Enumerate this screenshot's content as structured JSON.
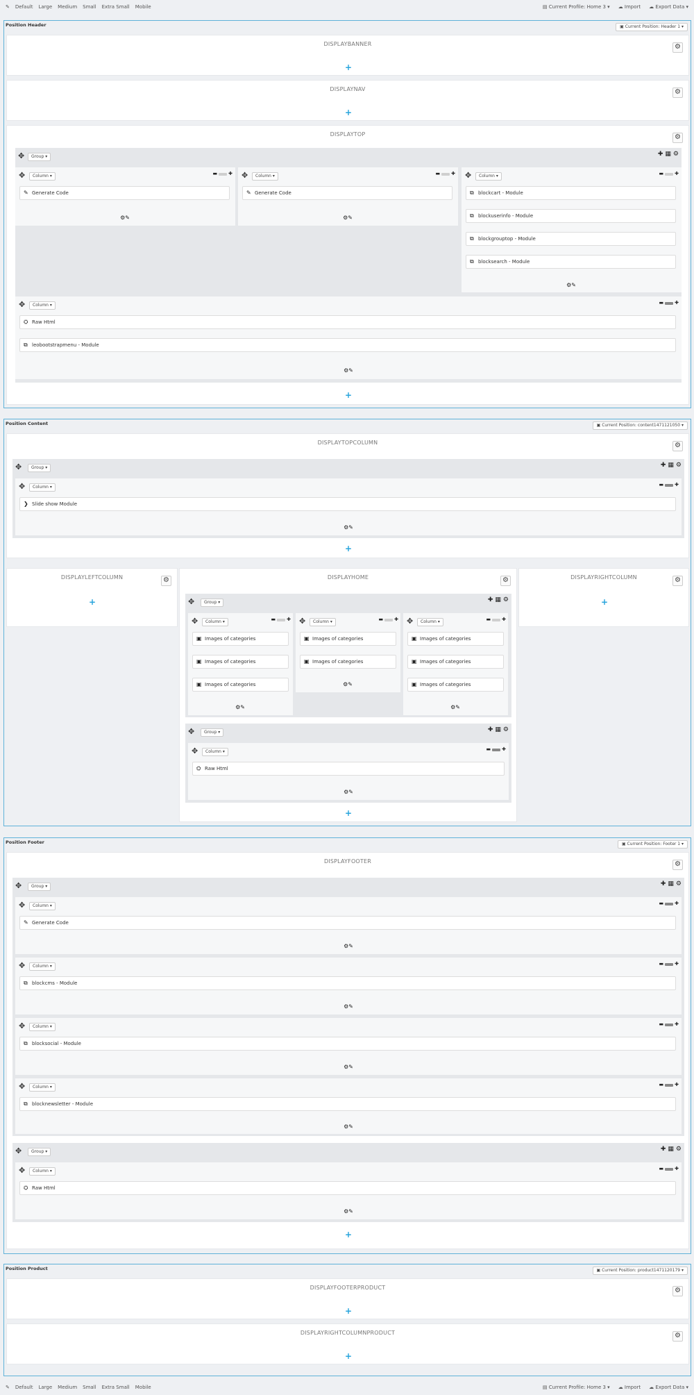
{
  "toolbar": {
    "left_icon": "wrench-icon",
    "devices": [
      "Default",
      "Large",
      "Medium",
      "Small",
      "Extra Small",
      "Mobile"
    ],
    "profile": "Current Profile: Home 3",
    "import": "Import",
    "export": "Export Data"
  },
  "sections": {
    "header": {
      "title": "Position Header",
      "current": "Current Position: Header 1"
    },
    "content": {
      "title": "Position Content",
      "current": "Current Position: content1471121050"
    },
    "footer": {
      "title": "Position Footer",
      "current": "Current Position: Footer 1"
    },
    "product": {
      "title": "Position Product",
      "current": "Current Position: product1471120179"
    }
  },
  "hooks": {
    "displaybanner": "DISPLAYBANNER",
    "displaynav": "DISPLAYNAV",
    "displaytop": "DISPLAYTOP",
    "displaytopcolumn": "DISPLAYTOPCOLUMN",
    "displayleftcolumn": "DISPLAYLEFTCOLUMN",
    "displayhome": "DISPLAYHOME",
    "displayrightcolumn": "DISPLAYRIGHTCOLUMN",
    "displayfooter": "DISPLAYFOOTER",
    "displayfooterproduct": "DISPLAYFOOTERPRODUCT",
    "displayrightcolumnproduct": "DISPLAYRIGHTCOLUMNPRODUCT"
  },
  "labels": {
    "group": "Group",
    "column": "Column"
  },
  "widgets": {
    "generate_code": "Generate Code",
    "blockcart": "blockcart - Module",
    "blockuserinfo": "blockuserinfo - Module",
    "blockgrouptop": "blockgrouptop - Module",
    "blocksearch": "blocksearch - Module",
    "raw_html": "Raw Html",
    "leobootstrapmenu": "leobootstrapmenu - Module",
    "slideshow": "Slide show Module",
    "images_of_categories": "Images of categories",
    "blockcms": "blockcms - Module",
    "blocksocial": "blocksocial - Module",
    "blocknewsletter": "blocknewsletter - Module"
  },
  "colors": {
    "accent": "#27a4dc",
    "section_border": "#5fb2d9"
  }
}
